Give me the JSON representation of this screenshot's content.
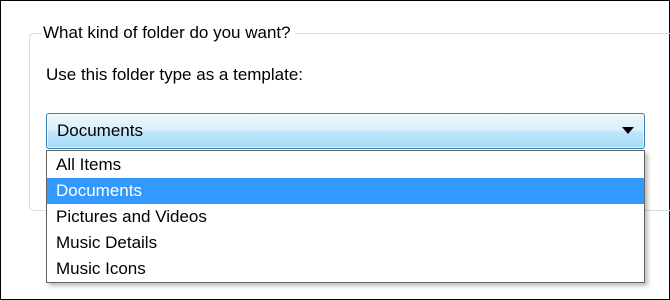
{
  "group": {
    "legend": "What kind of folder do you want?",
    "template_label": "Use this folder type as a template:"
  },
  "combo": {
    "selected": "Documents",
    "arrow_icon": "chevron-down-icon"
  },
  "dropdown": {
    "selected_index": 1,
    "options": [
      {
        "label": "All Items"
      },
      {
        "label": "Documents"
      },
      {
        "label": "Pictures and Videos"
      },
      {
        "label": "Music Details"
      },
      {
        "label": "Music Icons"
      }
    ]
  },
  "colors": {
    "selection_background": "#3399ff",
    "combo_border": "#3c7fb1"
  }
}
